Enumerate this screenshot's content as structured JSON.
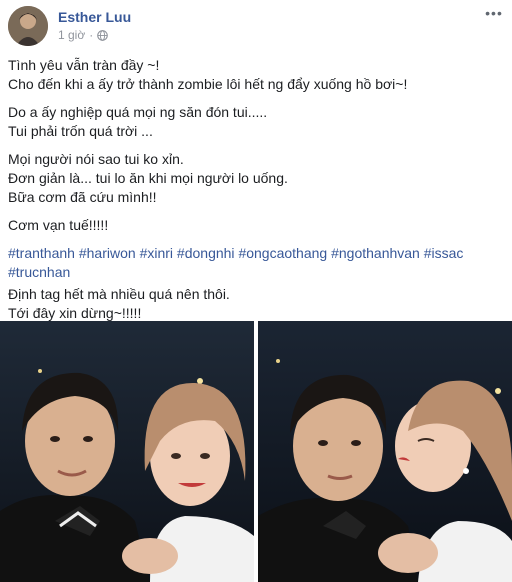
{
  "post": {
    "author": "Esther Luu",
    "time": "1 giờ",
    "separator": "·",
    "more": "•••",
    "paragraphs": [
      [
        "Tình yêu vẫn tràn đầy ~!",
        "Cho đến khi a ấy trở thành zombie lôi hết ng đẩy xuống hồ bơi~!"
      ],
      [
        "Do a ấy nghiệp quá mọi ng săn đón tui.....",
        "Tui phải trốn quá trời ..."
      ],
      [
        "Mọi người nói sao tui ko xỉn.",
        "Đơn giản là... tui lo ăn khi mọi người lo uống.",
        "Bữa cơm đã cứu mình!!"
      ],
      [
        "Cơm vạn tuế!!!!!"
      ]
    ],
    "hashtags": [
      "#tranthanh",
      "#hariwon",
      "#xinri",
      "#dongnhi",
      "#ongcaothang",
      "#ngothanhvan",
      "#issac",
      "#trucnhan"
    ],
    "closing": [
      "Định tag hết mà nhiều quá nên thôi.",
      "Tới đây xin dừng~!!!!!"
    ]
  },
  "icons": {
    "audience": "globe-icon",
    "menu": "more-options-icon"
  },
  "colors": {
    "link": "#385898",
    "meta": "#90949c",
    "text": "#1c1e21"
  }
}
